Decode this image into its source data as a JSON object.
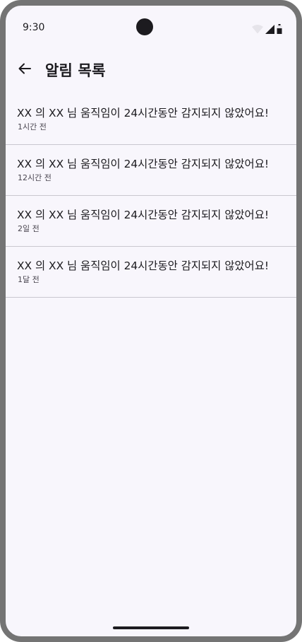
{
  "status_bar": {
    "time": "9:30",
    "icons": [
      "wifi-icon",
      "cellular-signal-icon",
      "battery-icon"
    ]
  },
  "app_bar": {
    "back_icon": "arrow-back-icon",
    "title": "알림 목록"
  },
  "notifications": [
    {
      "message": "XX 의 XX 님 움직임이 24시간동안 감지되지 않았어요!",
      "time": "1시간 전"
    },
    {
      "message": "XX 의 XX 님 움직임이 24시간동안 감지되지 않았어요!",
      "time": "12시간 전"
    },
    {
      "message": "XX 의 XX 님 움직임이 24시간동안 감지되지 않았어요!",
      "time": "2일 전"
    },
    {
      "message": "XX 의 XX 님 움직임이 24시간동안 감지되지 않았어요!",
      "time": "1달 전"
    }
  ],
  "colors": {
    "background": "#f8f6fc",
    "frame": "#747474",
    "text_primary": "#1c1b1f",
    "text_secondary": "#49454f",
    "divider": "#c9c7cf"
  }
}
